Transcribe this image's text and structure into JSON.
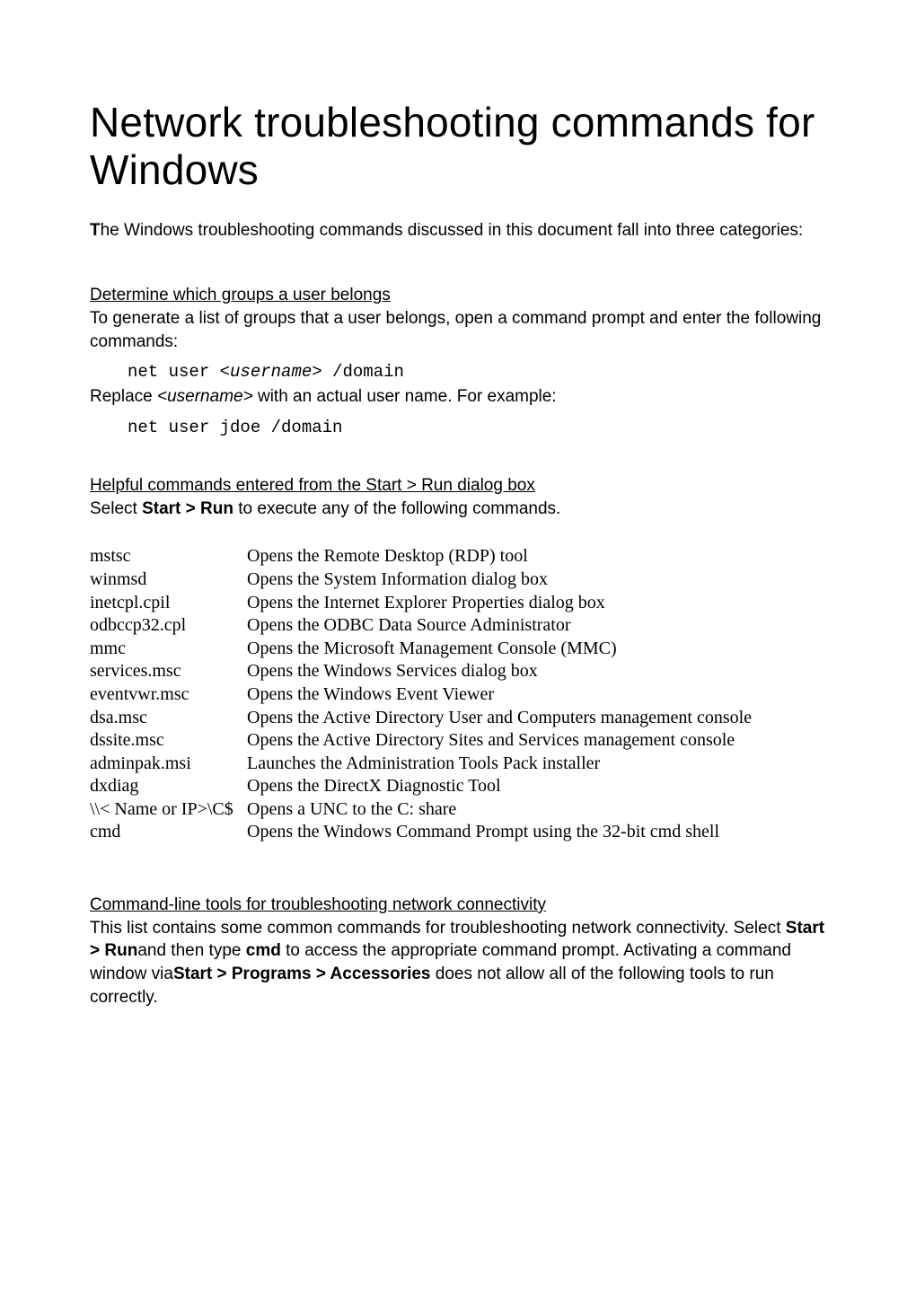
{
  "title": "Network troubleshooting commands for Windows",
  "intro_bold_T": "T",
  "intro_rest": "he Windows troubleshooting commands discussed in this document fall into three categories:",
  "sec1": {
    "heading": "Determine which groups a user belongs",
    "body": "To generate a list of groups that a user belongs, open a command prompt and enter the following commands:",
    "code1_pre": "net user ",
    "code1_arg": "<username>",
    "code1_post": " /domain",
    "replace_pre": "Replace ",
    "replace_arg": "<username>",
    "replace_post": " with an actual user name. For example:",
    "code2": "net user jdoe /domain"
  },
  "sec2": {
    "heading": "Helpful commands entered from the Start > Run dialog box",
    "body_pre": "Select ",
    "body_bold": "Start > Run",
    "body_post": " to execute any of the following commands.",
    "rows": [
      {
        "cmd": "mstsc",
        "desc": "Opens the Remote Desktop (RDP) tool"
      },
      {
        "cmd": "winmsd",
        "desc": "Opens the System Information dialog box"
      },
      {
        "cmd": "inetcpl.cpil",
        "desc": "Opens the Internet Explorer Properties dialog box"
      },
      {
        "cmd": "odbccp32.cpl",
        "desc": "Opens the ODBC Data Source Administrator"
      },
      {
        "cmd": "mmc",
        "desc": "Opens the Microsoft Management Console (MMC)"
      },
      {
        "cmd": "services.msc",
        "desc": "Opens the Windows Services dialog box"
      },
      {
        "cmd": "eventvwr.msc",
        "desc": "Opens the Windows Event Viewer"
      },
      {
        "cmd": "dsa.msc",
        "desc": "Opens the Active Directory User and Computers management console"
      },
      {
        "cmd": "dssite.msc",
        "desc": "Opens the Active Directory Sites and Services management console"
      },
      {
        "cmd": "adminpak.msi",
        "desc": "Launches the Administration Tools Pack installer"
      },
      {
        "cmd": "dxdiag",
        "desc": "Opens the DirectX Diagnostic Tool"
      },
      {
        "cmd": "\\\\< Name or IP>\\C$",
        "desc": "Opens a UNC to the C: share"
      },
      {
        "cmd": "cmd",
        "desc": "Opens the Windows Command Prompt using the 32-bit cmd shell"
      }
    ]
  },
  "sec3": {
    "heading": "Command-line tools for troubleshooting network connectivity",
    "p1_a": "This list contains some common commands for troubleshooting network connectivity. Select ",
    "p1_b_bold": "Start > Run",
    "p1_c": "and then type ",
    "p1_d_bold": "cmd",
    "p1_e": " to access the appropriate command prompt. Activating a command window via",
    "p1_f_bold": "Start > Programs > Accessories",
    "p1_g": " does not allow all of the following tools to run correctly."
  }
}
